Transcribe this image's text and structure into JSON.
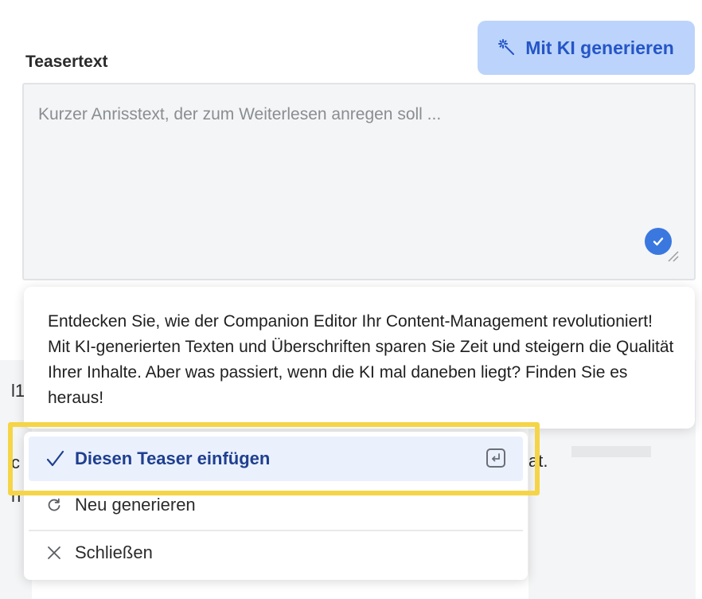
{
  "field": {
    "label": "Teasertext",
    "placeholder": "Kurzer Anrisstext, der zum Weiterlesen anregen soll ...",
    "value": ""
  },
  "ai_button": {
    "label": "Mit KI generieren",
    "icon": "magic-wand-icon",
    "background": "#bcd4fb",
    "color": "#2555c7"
  },
  "preview": {
    "text": "Entdecken Sie, wie der Companion Editor Ihr Content-Management revolutioniert! Mit KI-generierten Texten und Überschriften sparen Sie Zeit und steigern die Qualität Ihrer Inhalte. Aber was passiert, wenn die KI mal daneben liegt? Finden Sie es heraus!"
  },
  "menu": {
    "items": [
      {
        "label": "Diesen Teaser einfügen",
        "icon": "checkmark-icon",
        "shortcut_icon": "enter-key-icon",
        "active": true
      },
      {
        "label": "Neu generieren",
        "icon": "refresh-icon"
      },
      {
        "label": "Schließen",
        "icon": "close-icon"
      }
    ]
  },
  "background_fragments": {
    "left_a": "l1",
    "left_b": "c",
    "left_c": "n",
    "right": "at."
  },
  "colors": {
    "accent": "#3a78e0",
    "highlight": "#f5d547",
    "active_item_bg": "#eaf1fd"
  }
}
